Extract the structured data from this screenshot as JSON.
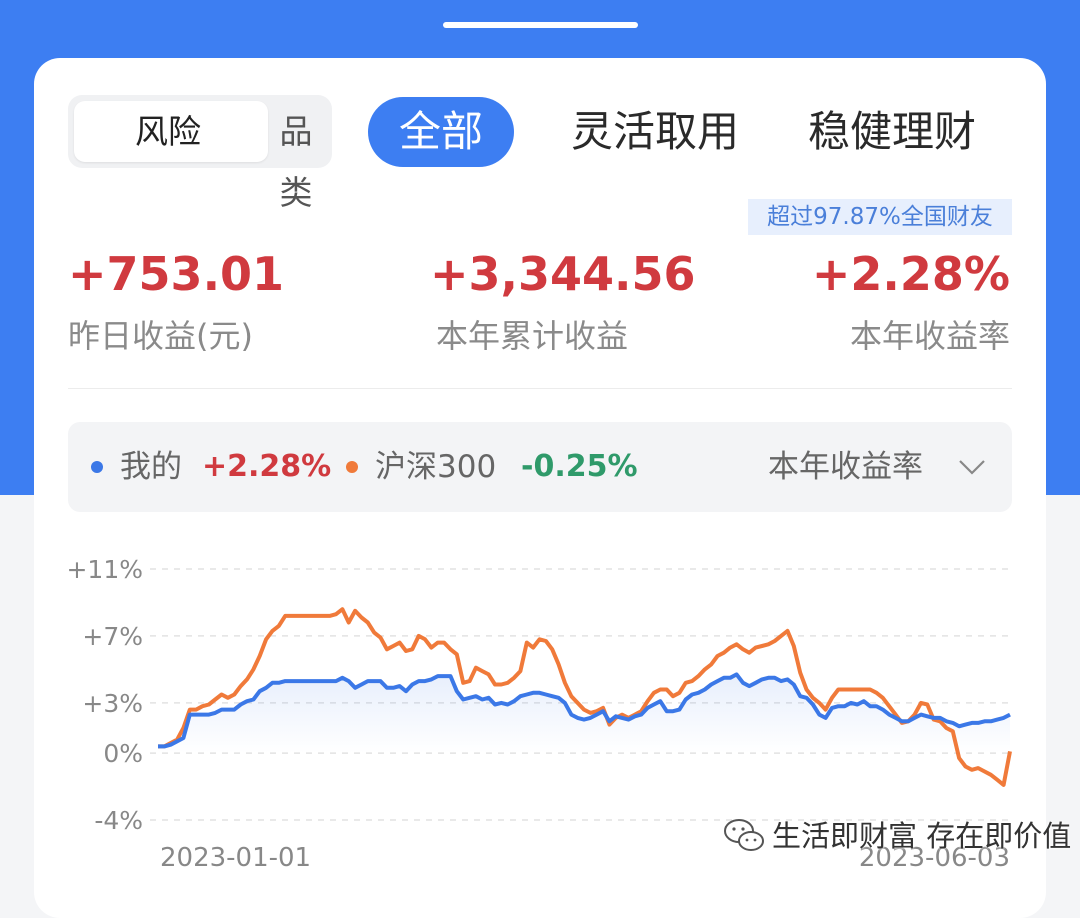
{
  "tabs": {
    "segment": [
      "风险",
      "品类"
    ],
    "active": "全部",
    "others": [
      "灵活取用",
      "稳健理财"
    ]
  },
  "rank_badge": "超过97.87%全国财友",
  "stats": [
    {
      "value": "+753.01",
      "label": "昨日收益(元)"
    },
    {
      "value": "+3,344.56",
      "label": "本年累计收益"
    },
    {
      "value": "+2.28%",
      "label": "本年收益率"
    }
  ],
  "legend": {
    "mine_label": "我的",
    "mine_value": "+2.28%",
    "index_label": "沪深300",
    "index_value": "-0.25%",
    "metric": "本年收益率"
  },
  "colors": {
    "brand_blue": "#3d7ef2",
    "mine_line": "#3b78e7",
    "index_line": "#f07a3a",
    "positive": "#d03a3f",
    "negative": "#2f9a6a"
  },
  "icons": {
    "metric_dropdown": "chevron-down-icon",
    "watermark": "wechat-icon"
  },
  "watermark": "生活即财富 存在即价值",
  "chart_data": {
    "type": "line",
    "y_ticks": [
      "+11%",
      "+7%",
      "+3%",
      "0%",
      "-4%"
    ],
    "y_tick_values": [
      11,
      7,
      3,
      0,
      -4
    ],
    "ylim": [
      -4,
      11
    ],
    "x_labels": [
      "2023-01-01",
      "2023-06-03"
    ],
    "series": [
      {
        "name": "我的",
        "values": [
          0.4,
          0.4,
          0.5,
          0.7,
          0.9,
          2.3,
          2.3,
          2.3,
          2.3,
          2.4,
          2.6,
          2.6,
          2.6,
          2.9,
          3.1,
          3.2,
          3.7,
          3.9,
          4.2,
          4.2,
          4.3,
          4.3,
          4.3,
          4.3,
          4.3,
          4.3,
          4.3,
          4.3,
          4.3,
          4.5,
          4.3,
          3.9,
          4.1,
          4.3,
          4.3,
          4.3,
          3.9,
          3.9,
          4.0,
          3.7,
          4.1,
          4.3,
          4.3,
          4.4,
          4.6,
          4.6,
          4.6,
          3.7,
          3.2,
          3.3,
          3.4,
          3.2,
          3.3,
          2.9,
          3.0,
          2.9,
          3.1,
          3.4,
          3.5,
          3.6,
          3.6,
          3.5,
          3.4,
          3.3,
          3.0,
          2.3,
          2.1,
          2.0,
          2.1,
          2.3,
          2.5,
          1.9,
          2.2,
          2.1,
          2.0,
          2.2,
          2.3,
          2.7,
          2.9,
          3.1,
          2.5,
          2.5,
          2.6,
          3.2,
          3.5,
          3.6,
          3.8,
          4.1,
          4.3,
          4.5,
          4.5,
          4.7,
          4.2,
          4.0,
          4.2,
          4.4,
          4.5,
          4.5,
          4.3,
          4.4,
          4.1,
          3.4,
          3.3,
          2.9,
          2.3,
          2.1,
          2.7,
          2.8,
          2.8,
          3.0,
          2.9,
          3.1,
          2.8,
          2.8,
          2.6,
          2.3,
          2.1,
          1.9,
          1.9,
          2.1,
          2.3,
          2.2,
          2.1,
          2.1,
          1.9,
          1.8,
          1.6,
          1.7,
          1.8,
          1.8,
          1.9,
          1.9,
          2.0,
          2.1,
          2.3
        ]
      },
      {
        "name": "沪深300",
        "values": [
          0.4,
          0.4,
          0.6,
          0.8,
          1.5,
          2.6,
          2.6,
          2.8,
          2.9,
          3.2,
          3.5,
          3.3,
          3.5,
          4.0,
          4.4,
          5.0,
          5.8,
          6.8,
          7.3,
          7.6,
          8.2,
          8.2,
          8.2,
          8.2,
          8.2,
          8.2,
          8.2,
          8.2,
          8.3,
          8.6,
          7.8,
          8.5,
          8.1,
          7.8,
          7.2,
          6.9,
          6.2,
          6.4,
          6.6,
          6.1,
          6.2,
          7.0,
          6.8,
          6.3,
          6.6,
          6.6,
          6.2,
          5.9,
          4.2,
          4.3,
          5.1,
          4.9,
          4.7,
          4.1,
          4.1,
          4.2,
          4.5,
          4.9,
          6.6,
          6.3,
          6.8,
          6.7,
          6.2,
          5.3,
          4.2,
          3.4,
          3.0,
          2.6,
          2.4,
          2.5,
          2.7,
          1.7,
          2.1,
          2.3,
          2.1,
          2.3,
          2.5,
          3.1,
          3.6,
          3.8,
          3.8,
          3.4,
          3.6,
          4.2,
          4.3,
          4.6,
          5.0,
          5.3,
          5.8,
          6.0,
          6.3,
          6.5,
          6.2,
          6.0,
          6.3,
          6.4,
          6.5,
          6.7,
          7.0,
          7.3,
          6.4,
          4.8,
          3.8,
          3.3,
          3.0,
          2.6,
          3.3,
          3.8,
          3.8,
          3.8,
          3.8,
          3.8,
          3.8,
          3.6,
          3.3,
          2.8,
          2.3,
          1.8,
          1.9,
          2.3,
          3.0,
          2.9,
          2.0,
          1.9,
          1.5,
          1.3,
          -0.3,
          -0.8,
          -1.0,
          -0.9,
          -1.1,
          -1.3,
          -1.6,
          -1.9,
          0.1
        ]
      }
    ],
    "grid": true
  }
}
